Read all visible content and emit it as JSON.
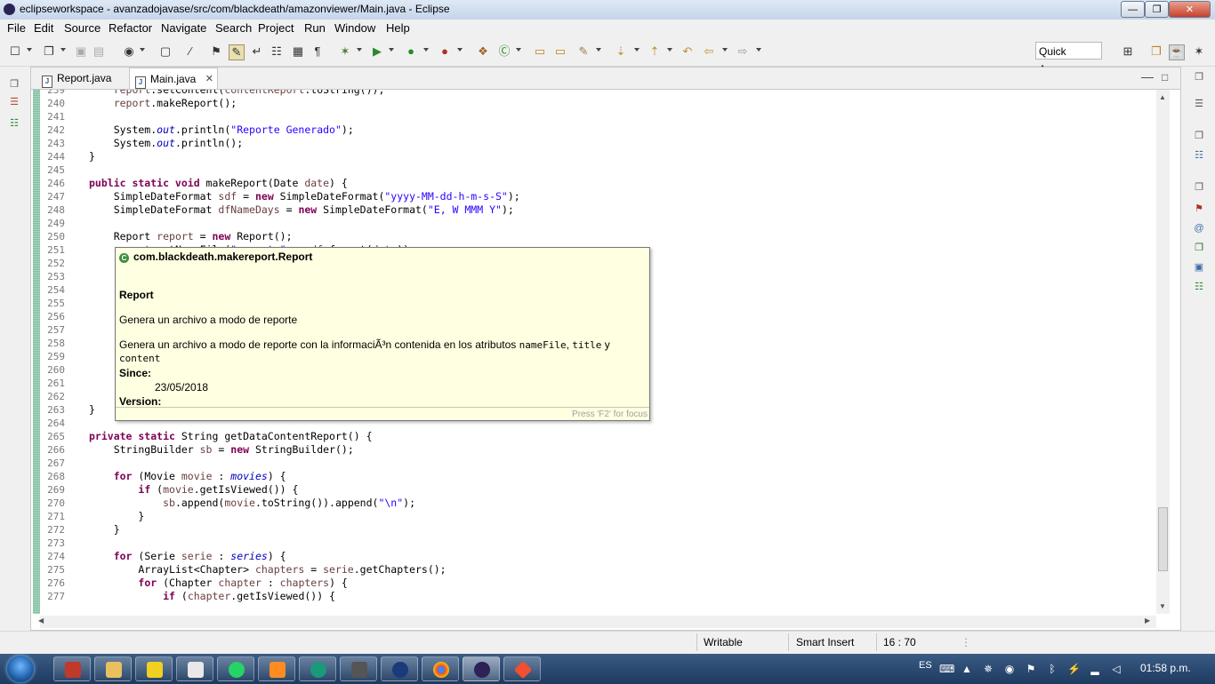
{
  "window": {
    "title": "eclipseworkspace - avanzadojavase/src/com/blackdeath/amazonviewer/Main.java - Eclipse",
    "minimize": "—",
    "maximize": "❐",
    "close": "✕"
  },
  "menu": [
    "File",
    "Edit",
    "Source",
    "Refactor",
    "Navigate",
    "Search",
    "Project",
    "Run",
    "Window",
    "Help"
  ],
  "toolbar": {
    "quick_access": "Quick Access",
    "icons": [
      "new-icon",
      "save-icon",
      "save-all-icon",
      "print-icon",
      "debug-perspective-icon",
      "external-tools-icon",
      "toggle-mark-icon",
      "link-icon",
      "debug-icon",
      "run-icon",
      "coverage-icon",
      "external-run-icon",
      "new-java-project-icon",
      "new-class-icon",
      "open-type-icon",
      "search-icon",
      "next-annotation-icon",
      "prev-annotation-icon",
      "back-icon",
      "forward-icon"
    ]
  },
  "tabs": [
    {
      "label": "Report.java",
      "icon": "J"
    },
    {
      "label": "Main.java",
      "icon": "J",
      "close": "✕"
    }
  ],
  "editor": {
    "line_numbers": [
      "239",
      "240",
      "241",
      "242",
      "243",
      "244",
      "245",
      "246",
      "247",
      "248",
      "249",
      "250",
      "251",
      "252",
      "253",
      "254",
      "255",
      "256",
      "257",
      "258",
      "259",
      "260",
      "261",
      "262",
      "263",
      "264",
      "265",
      "266",
      "267",
      "268",
      "269",
      "270",
      "271",
      "272",
      "273",
      "274",
      "275",
      "276",
      "277"
    ],
    "top_clipped_line": "report.setContent(contentReport.toString());"
  },
  "tooltip": {
    "header": "com.blackdeath.makereport.Report",
    "class_name": "Report",
    "summary": "Genera un archivo a modo de reporte",
    "detail_prefix": "Genera un archivo a modo de reporte con la informaciÃ³n contenida en los atributos ",
    "attr1": "nameFile",
    "sep1": ", ",
    "attr2": "title",
    "sep2": " y",
    "attr3": "content",
    "since_label": "Since:",
    "since_value": "23/05/2018",
    "version_label": "Version:",
    "footer": "Press 'F2' for focus"
  },
  "statusbar": {
    "writable": "Writable",
    "insert_mode": "Smart Insert",
    "position": "16 : 70"
  },
  "taskbar": {
    "apps": [
      "file-manager",
      "explorer",
      "media-player",
      "word-app",
      "whatsapp",
      "sublime",
      "gitkraken",
      "filezilla",
      "vpn",
      "chrome",
      "eclipse",
      "git"
    ],
    "lang": "ES",
    "time": "01:58 p.m."
  }
}
